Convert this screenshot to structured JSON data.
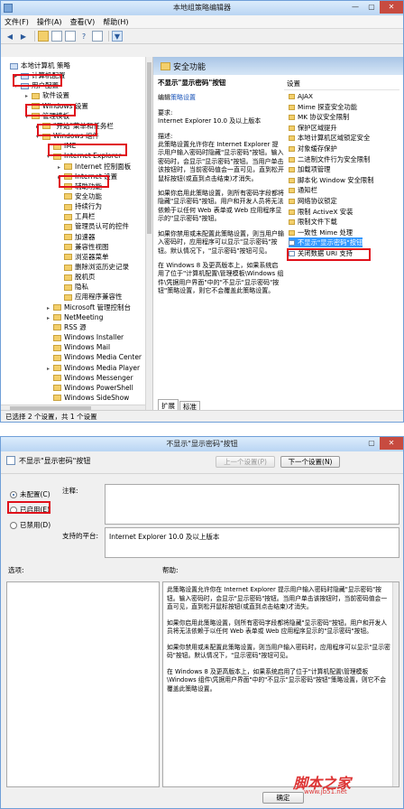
{
  "editor": {
    "title": "本地组策略编辑器",
    "menu": [
      "文件(F)",
      "操作(A)",
      "查看(V)",
      "帮助(H)"
    ],
    "tree": [
      {
        "label": "本地计算机 策略",
        "indent": 0,
        "kind": "pc",
        "toggle": ""
      },
      {
        "label": "计算机配置",
        "indent": 1,
        "kind": "pc",
        "toggle": "▸"
      },
      {
        "label": "用户配置",
        "indent": 1,
        "kind": "pc",
        "toggle": "▾"
      },
      {
        "label": "软件设置",
        "indent": 2,
        "kind": "folder",
        "toggle": "▸"
      },
      {
        "label": "Windows 设置",
        "indent": 2,
        "kind": "folder",
        "toggle": "▸"
      },
      {
        "label": "管理模板",
        "indent": 2,
        "kind": "folder",
        "toggle": "▾"
      },
      {
        "label": "\"开始\"菜单和任务栏",
        "indent": 3,
        "kind": "folder",
        "toggle": "▸"
      },
      {
        "label": "Windows 组件",
        "indent": 3,
        "kind": "folder",
        "toggle": "▾"
      },
      {
        "label": "IME",
        "indent": 4,
        "kind": "folder",
        "toggle": ""
      },
      {
        "label": "Internet Explorer",
        "indent": 4,
        "kind": "folder",
        "toggle": "▾"
      },
      {
        "label": "Internet 控制面板",
        "indent": 5,
        "kind": "folder",
        "toggle": "▸"
      },
      {
        "label": "Internet 设置",
        "indent": 5,
        "kind": "folder",
        "toggle": "▸"
      },
      {
        "label": "辅助功能",
        "indent": 5,
        "kind": "folder",
        "toggle": ""
      },
      {
        "label": "安全功能",
        "indent": 5,
        "kind": "folder",
        "toggle": ""
      },
      {
        "label": "持续行为",
        "indent": 5,
        "kind": "folder",
        "toggle": ""
      },
      {
        "label": "工具栏",
        "indent": 5,
        "kind": "folder",
        "toggle": ""
      },
      {
        "label": "管理员认可的控件",
        "indent": 5,
        "kind": "folder",
        "toggle": ""
      },
      {
        "label": "加速器",
        "indent": 5,
        "kind": "folder",
        "toggle": ""
      },
      {
        "label": "兼容性视图",
        "indent": 5,
        "kind": "folder",
        "toggle": ""
      },
      {
        "label": "浏览器菜单",
        "indent": 5,
        "kind": "folder",
        "toggle": ""
      },
      {
        "label": "删除浏览历史记录",
        "indent": 5,
        "kind": "folder",
        "toggle": ""
      },
      {
        "label": "脱机页",
        "indent": 5,
        "kind": "folder",
        "toggle": ""
      },
      {
        "label": "隐私",
        "indent": 5,
        "kind": "folder",
        "toggle": ""
      },
      {
        "label": "应用程序兼容性",
        "indent": 5,
        "kind": "folder",
        "toggle": ""
      },
      {
        "label": "Microsoft 管理控制台",
        "indent": 4,
        "kind": "folder",
        "toggle": "▸"
      },
      {
        "label": "NetMeeting",
        "indent": 4,
        "kind": "folder",
        "toggle": "▸"
      },
      {
        "label": "RSS 源",
        "indent": 4,
        "kind": "folder",
        "toggle": ""
      },
      {
        "label": "Windows Installer",
        "indent": 4,
        "kind": "folder",
        "toggle": ""
      },
      {
        "label": "Windows Mail",
        "indent": 4,
        "kind": "folder",
        "toggle": ""
      },
      {
        "label": "Windows Media Center",
        "indent": 4,
        "kind": "folder",
        "toggle": ""
      },
      {
        "label": "Windows Media Player",
        "indent": 4,
        "kind": "folder",
        "toggle": "▸"
      },
      {
        "label": "Windows Messenger",
        "indent": 4,
        "kind": "folder",
        "toggle": ""
      },
      {
        "label": "Windows PowerShell",
        "indent": 4,
        "kind": "folder",
        "toggle": ""
      },
      {
        "label": "Windows SideShow",
        "indent": 4,
        "kind": "folder",
        "toggle": ""
      }
    ],
    "right_header": "安全功能",
    "desc": {
      "title": "不显示\"显示密码\"按钮",
      "edit_prefix": "编辑",
      "edit_link": "策略设置",
      "req_label": "要求:",
      "req_text": "Internet Explorer 10.0 及以上版本",
      "desc_label": "描述:",
      "p1": "此策略设置允许你在 Internet Explorer 提示用户输入密码时隐藏\"显示密码\"按钮。输入密码时，会显示\"显示密码\"按钮。当用户单击该按钮时，当前密码值会一直可见，直到松开鼠标按钮(或直到点击结束)才消失。",
      "p2": "如果你启用此策略设置，则所有密码字段都将隐藏\"显示密码\"按钮。用户和开发人员将无法依赖于以任何 Web 表单或 Web 应用程序显示的\"显示密码\"按钮。",
      "p3": "如果你禁用或未配置此策略设置，则当用户输入密码时，应用程序可以显示\"显示密码\"按钮。默认情况下，\"显示密码\"按钮可见。",
      "p4": "在 Windows 8 及更高版本上，如果系统启用了位于\"计算机配置\\管理模板\\Windows 组件\\凭据用户界面\"中的\"不显示\"显示密码\"按钮\"策略设置，则它不会覆盖此策略设置。"
    },
    "settings_header": "设置",
    "settings": [
      {
        "label": "AJAX",
        "kind": "folder"
      },
      {
        "label": "Mime 探查安全功能",
        "kind": "folder"
      },
      {
        "label": "MK 协议安全限制",
        "kind": "folder"
      },
      {
        "label": "保护区域提升",
        "kind": "folder"
      },
      {
        "label": "本地计算机区域锁定安全",
        "kind": "folder"
      },
      {
        "label": "对象缓存保护",
        "kind": "folder"
      },
      {
        "label": "二进制文件行为安全限制",
        "kind": "folder"
      },
      {
        "label": "加载项管理",
        "kind": "folder"
      },
      {
        "label": "脚本化 Window 安全限制",
        "kind": "folder"
      },
      {
        "label": "通知栏",
        "kind": "folder"
      },
      {
        "label": "网络协议锁定",
        "kind": "folder"
      },
      {
        "label": "限制 ActiveX 安装",
        "kind": "folder"
      },
      {
        "label": "限制文件下载",
        "kind": "folder"
      },
      {
        "label": "一致性 Mime 处理",
        "kind": "folder"
      },
      {
        "label": "不显示\"显示密码\"按钮",
        "kind": "policy"
      },
      {
        "label": "关闭数据 URI 支持",
        "kind": "policy"
      }
    ],
    "tabs": [
      "扩展",
      "标准"
    ],
    "status": "已选择 2 个设置，共 1 个设置"
  },
  "dialog": {
    "title": "不显示\"显示密码\"按钮",
    "policy_title": "不显示\"显示密码\"按钮",
    "prev_btn": "上一个设置(P)",
    "next_btn": "下一个设置(N)",
    "radio_unconfigured": "未配置(C)",
    "radio_enabled": "已启用(E)",
    "radio_disabled": "已禁用(D)",
    "comment_label": "注释:",
    "supported_label": "支持的平台:",
    "supported_value": "Internet Explorer 10.0 及以上版本",
    "options_label": "选项:",
    "help_label": "帮助:",
    "help_p1": "此策略设置允许你在 Internet Explorer 提示用户输入密码时隐藏\"显示密码\"按钮。输入密码时，会显示\"显示密码\"按钮。当用户单击该按钮时，当前密码值会一直可见，直到松开鼠标按钮(或直到点击结束)才消失。",
    "help_p2": "如果你启用此策略设置，则所有密码字段都将隐藏\"显示密码\"按钮。用户和开发人员将无法依赖于以任何 Web 表单或 Web 应用程序显示的\"显示密码\"按钮。",
    "help_p3": "如果你禁用或未配置此策略设置，则当用户输入密码时，应用程序可以显示\"显示密码\"按钮。默认情况下，\"显示密码\"按钮可见。",
    "help_p4": "在 Windows 8 及更高版本上，如果系统启用了位于\"计算机配置\\管理模板\\Windows 组件\\凭据用户界面\"中的\"不显示\"显示密码\"按钮\"策略设置，则它不会覆盖此策略设置。",
    "ok_btn": "确定"
  },
  "watermark": {
    "main": "脚本之家",
    "sub": "www.jb51.net"
  },
  "colors": {
    "highlight": "#e0101a",
    "selection": "#3399ff",
    "link": "#1a54b9"
  }
}
